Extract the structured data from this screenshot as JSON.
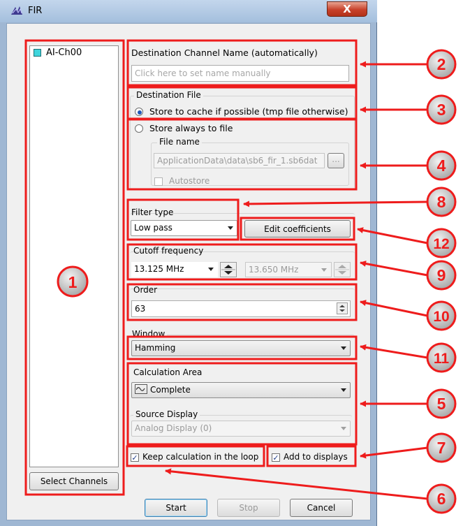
{
  "window": {
    "title": "FIR",
    "close_label": "X"
  },
  "channels": {
    "items": [
      {
        "label": "AI-Ch00",
        "color": "#3fd5dc"
      }
    ],
    "select_button": "Select Channels"
  },
  "destination_channel": {
    "label": "Destination Channel Name (automatically)",
    "placeholder": "Click here to set name manually"
  },
  "destination_file": {
    "group_label": "Destination File",
    "cache_option": "Store to cache if possible (tmp file otherwise)",
    "file_option": "Store always to file",
    "file_name_label": "File name",
    "file_name_value": "ApplicationData\\data\\sb6_fir_1.sb6dat",
    "browse_label": "...",
    "autostore_label": "Autostore"
  },
  "filter_type": {
    "label": "Filter type",
    "value": "Low pass",
    "edit_button": "Edit coefficients"
  },
  "cutoff": {
    "label": "Cutoff frequency",
    "value1": "13.125 MHz",
    "value2": "13.650 MHz"
  },
  "order": {
    "label": "Order",
    "value": "63"
  },
  "window_fn": {
    "label": "Window",
    "value": "Hamming"
  },
  "calc_area": {
    "label": "Calculation Area",
    "value": "Complete",
    "source_label": "Source Display",
    "source_value": "Analog Display (0)"
  },
  "options": {
    "keep_loop": "Keep calculation in the loop",
    "add_displays": "Add to displays"
  },
  "actions": {
    "start": "Start",
    "stop": "Stop",
    "cancel": "Cancel"
  },
  "callouts": [
    "1",
    "2",
    "3",
    "4",
    "5",
    "6",
    "7",
    "8",
    "9",
    "10",
    "11",
    "12"
  ],
  "colors": {
    "annotation": "#ee1c1c",
    "callout_fill": "#bdbdbd"
  }
}
